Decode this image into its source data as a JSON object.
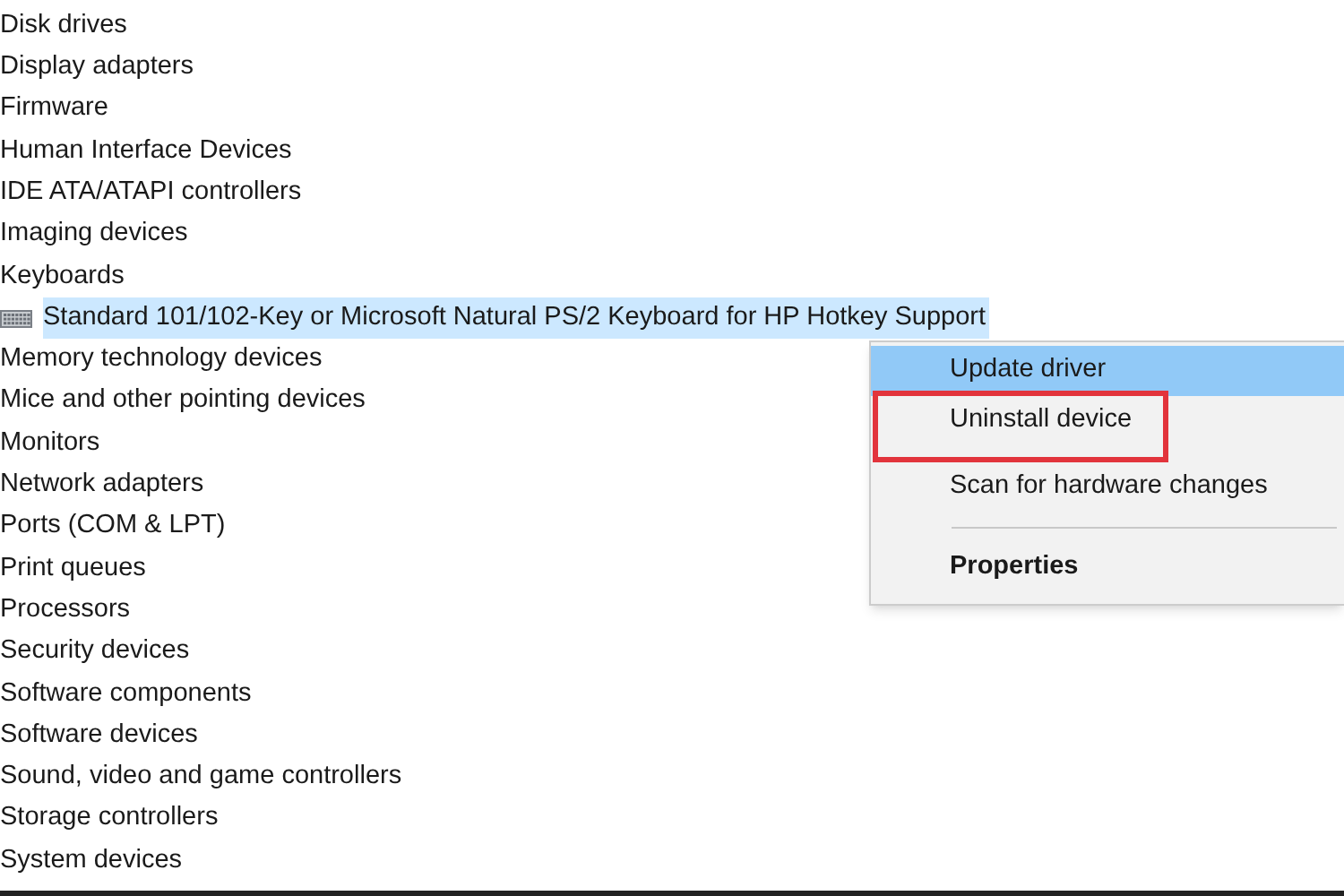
{
  "tree": [
    {
      "label": "Disk drives",
      "selected": false
    },
    {
      "label": "Display adapters",
      "selected": false
    },
    {
      "label": "Firmware",
      "selected": false
    },
    {
      "label": "Human Interface Devices",
      "selected": false
    },
    {
      "label": "IDE ATA/ATAPI controllers",
      "selected": false
    },
    {
      "label": "Imaging devices",
      "selected": false
    },
    {
      "label": "Keyboards",
      "selected": false,
      "children": [
        {
          "label": "Standard 101/102-Key or Microsoft Natural PS/2 Keyboard for HP Hotkey Support",
          "selected": true
        }
      ]
    },
    {
      "label": "Memory technology devices",
      "selected": false
    },
    {
      "label": "Mice and other pointing devices",
      "selected": false
    },
    {
      "label": "Monitors",
      "selected": false
    },
    {
      "label": "Network adapters",
      "selected": false
    },
    {
      "label": "Ports (COM & LPT)",
      "selected": false
    },
    {
      "label": "Print queues",
      "selected": false
    },
    {
      "label": "Processors",
      "selected": false
    },
    {
      "label": "Security devices",
      "selected": false
    },
    {
      "label": "Software components",
      "selected": false
    },
    {
      "label": "Software devices",
      "selected": false
    },
    {
      "label": "Sound, video and game controllers",
      "selected": false
    },
    {
      "label": "Storage controllers",
      "selected": false
    },
    {
      "label": "System devices",
      "selected": false
    }
  ],
  "context_menu": [
    {
      "kind": "item",
      "label": "Update driver",
      "selected": true,
      "outlined": false,
      "bold": false
    },
    {
      "kind": "item",
      "label": "Uninstall device",
      "selected": false,
      "outlined": true,
      "bold": false
    },
    {
      "kind": "item",
      "label": "Scan for hardware changes",
      "selected": false,
      "outlined": false,
      "bold": false
    },
    {
      "kind": "separator"
    },
    {
      "kind": "item",
      "label": "Properties",
      "selected": false,
      "outlined": false,
      "bold": true
    }
  ]
}
